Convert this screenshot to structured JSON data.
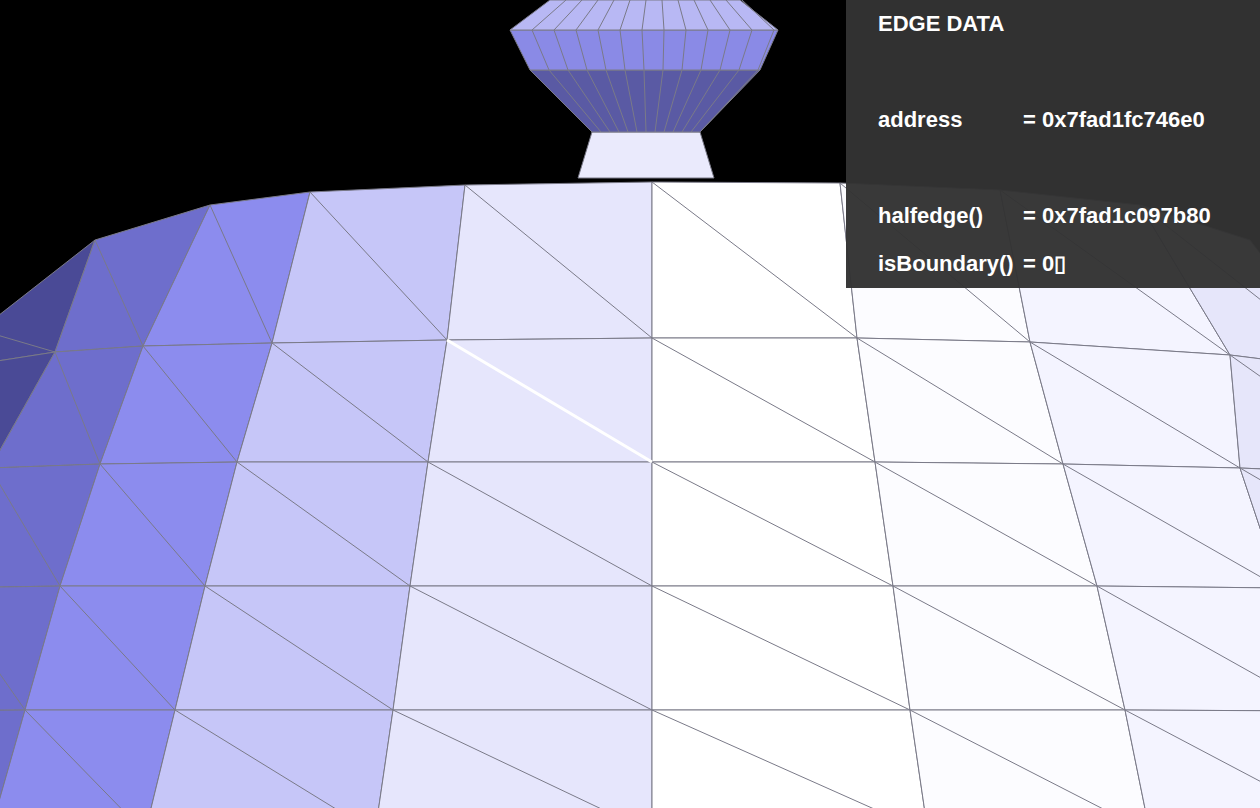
{
  "viewport": {
    "edge_highlighted": true
  },
  "panel": {
    "title": "EDGE DATA",
    "sections": [
      [
        {
          "label": "address",
          "value": "= 0x7fad1fc746e0"
        }
      ],
      [
        {
          "label": "halfedge()",
          "value": "= 0x7fad1c097b80"
        },
        {
          "label": "isBoundary()",
          "value": "= 0▯"
        }
      ]
    ]
  }
}
